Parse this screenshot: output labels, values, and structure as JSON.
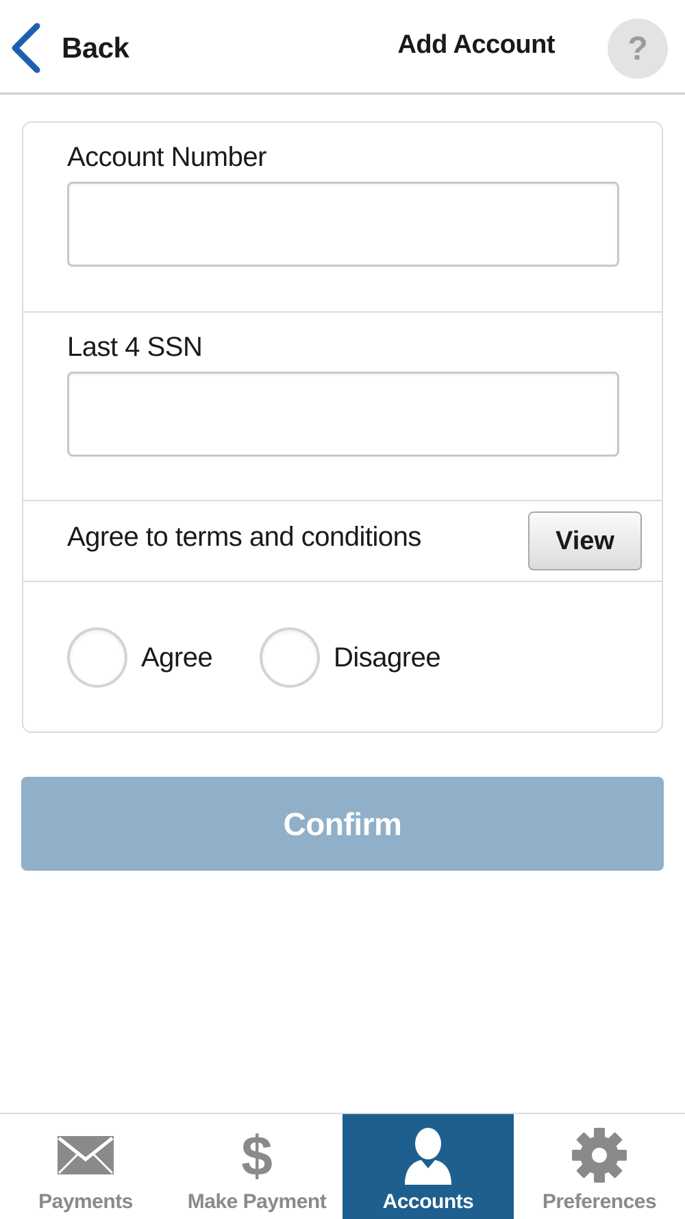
{
  "header": {
    "back_label": "Back",
    "title": "Add Account",
    "help_symbol": "?"
  },
  "form": {
    "account_number": {
      "label": "Account Number",
      "value": "",
      "placeholder": ""
    },
    "ssn": {
      "label": "Last 4 SSN",
      "value": "",
      "placeholder": ""
    },
    "terms": {
      "label": "Agree to terms and conditions",
      "view_label": "View"
    },
    "radios": [
      {
        "label": "Agree",
        "selected": false
      },
      {
        "label": "Disagree",
        "selected": false
      }
    ]
  },
  "confirm": {
    "label": "Confirm",
    "state": "disabled"
  },
  "tabs": [
    {
      "label": "Payments",
      "icon": "envelope-icon",
      "active": false
    },
    {
      "label": "Make Payment",
      "icon": "dollar-icon",
      "active": false
    },
    {
      "label": "Accounts",
      "icon": "person-icon",
      "active": true
    },
    {
      "label": "Preferences",
      "icon": "gear-icon",
      "active": false
    }
  ],
  "colors": {
    "accent": "#1f5f8f",
    "back_chevron": "#1f5fb0",
    "confirm_disabled": "#8fb0c8"
  }
}
